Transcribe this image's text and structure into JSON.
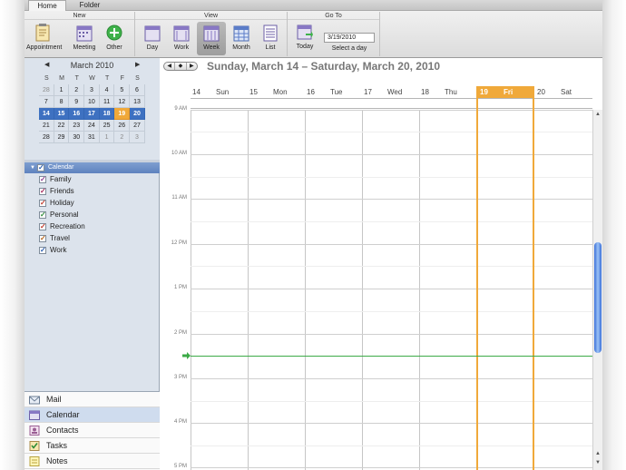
{
  "tabs": [
    "Home",
    "Folder"
  ],
  "ribbon": {
    "new_group": "New",
    "view_group": "View",
    "goto_group": "Go To",
    "appointment": "Appointment",
    "meeting": "Meeting",
    "other": "Other",
    "day": "Day",
    "work": "Work",
    "week": "Week",
    "month": "Month",
    "list": "List",
    "today": "Today",
    "date_value": "3/19/2010",
    "select_day": "Select a day"
  },
  "mini_calendar": {
    "title": "March 2010",
    "prev": "◀",
    "next": "▶",
    "weekdays": [
      "S",
      "M",
      "T",
      "W",
      "T",
      "F",
      "S"
    ],
    "weeks": [
      [
        "28",
        "1",
        "2",
        "3",
        "4",
        "5",
        "6"
      ],
      [
        "7",
        "8",
        "9",
        "10",
        "11",
        "12",
        "13"
      ],
      [
        "14",
        "15",
        "16",
        "17",
        "18",
        "19",
        "20"
      ],
      [
        "21",
        "22",
        "23",
        "24",
        "25",
        "26",
        "27"
      ],
      [
        "28",
        "29",
        "30",
        "31",
        "1",
        "2",
        "3"
      ]
    ]
  },
  "calendars": {
    "root": "Calendar",
    "items": [
      {
        "label": "Family",
        "color": "#8e3c8e"
      },
      {
        "label": "Friends",
        "color": "#a3245a"
      },
      {
        "label": "Holiday",
        "color": "#c0392b"
      },
      {
        "label": "Personal",
        "color": "#2e8b3a"
      },
      {
        "label": "Recreation",
        "color": "#c0392b"
      },
      {
        "label": "Travel",
        "color": "#b5651d"
      },
      {
        "label": "Work",
        "color": "#2a5db0"
      }
    ]
  },
  "modules": [
    "Mail",
    "Calendar",
    "Contacts",
    "Tasks",
    "Notes"
  ],
  "week": {
    "range_title": "Sunday, March 14 – Saturday, March 20, 2010",
    "days": [
      {
        "num": "14",
        "name": "Sun"
      },
      {
        "num": "15",
        "name": "Mon"
      },
      {
        "num": "16",
        "name": "Tue"
      },
      {
        "num": "17",
        "name": "Wed"
      },
      {
        "num": "18",
        "name": "Thu"
      },
      {
        "num": "19",
        "name": "Fri"
      },
      {
        "num": "20",
        "name": "Sat"
      }
    ],
    "times": [
      "9 AM",
      "10 AM",
      "11 AM",
      "12 PM",
      "1 PM",
      "2 PM",
      "3 PM",
      "4 PM",
      "5 PM"
    ]
  },
  "colors": {
    "today_accent": "#f0a93a",
    "selected_week": "#3e71c1",
    "now_line": "#3caa47"
  }
}
